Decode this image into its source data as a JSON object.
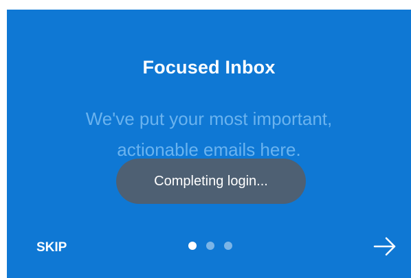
{
  "onboarding": {
    "title": "Focused Inbox",
    "subtitle_line1": "We've put your most important,",
    "subtitle_line2": "actionable emails here.",
    "toast": "Completing login...",
    "skip_label": "SKIP",
    "page_indicator": {
      "total": 3,
      "current": 1
    },
    "next_icon": "arrow-right-icon"
  },
  "colors": {
    "background": "#0f78d4",
    "subtitle": "#6ab3ef",
    "toast_bg": "#545e6a",
    "text": "#ffffff"
  }
}
